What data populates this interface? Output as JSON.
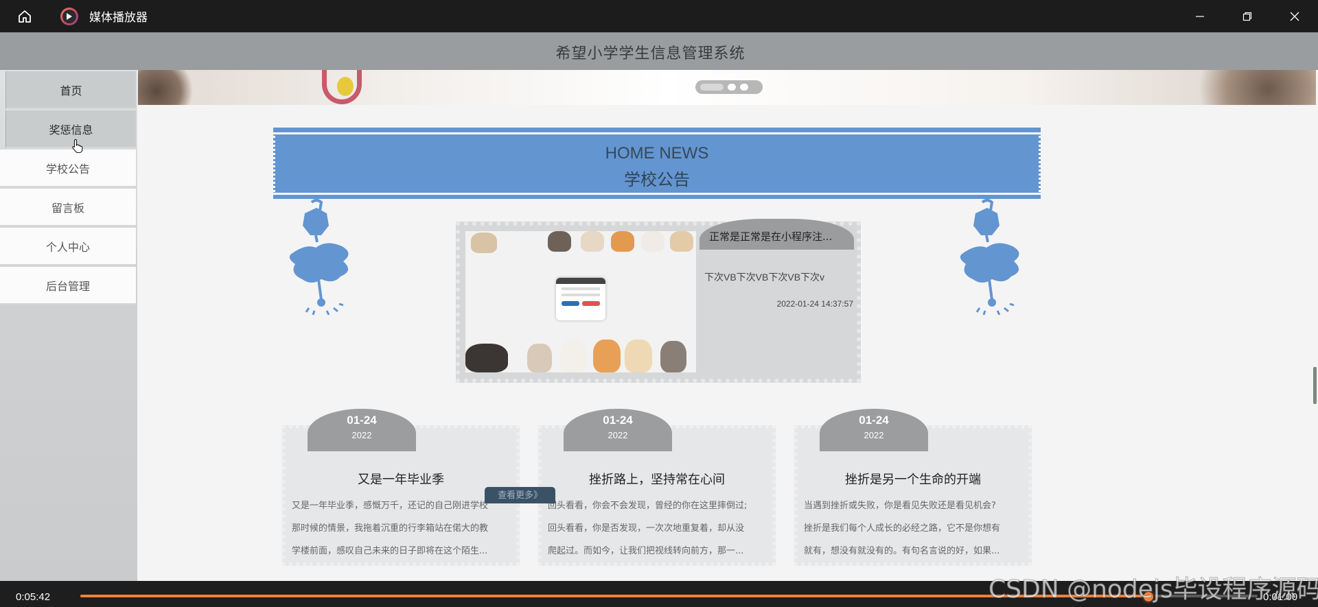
{
  "player": {
    "title": "媒体播放器",
    "time_current": "0:05:42",
    "time_end": "0:01:00",
    "progress": 0.907
  },
  "site": {
    "title": "希望小学学生信息管理系统"
  },
  "sidebar": {
    "items": [
      {
        "label": "首页"
      },
      {
        "label": "奖惩信息"
      },
      {
        "label": "学校公告"
      },
      {
        "label": "留言板"
      },
      {
        "label": "个人中心"
      },
      {
        "label": "后台管理"
      }
    ]
  },
  "news_banner": {
    "title_en": "HOME NEWS",
    "title_cn": "学校公告"
  },
  "featured": {
    "title": "正常是正常是在小程序注...",
    "description": "下次VB下次VB下次VB下次v",
    "datetime": "2022-01-24 14:37:57"
  },
  "cards": [
    {
      "date": "01-24",
      "year": "2022",
      "title": "又是一年毕业季",
      "lines": [
        "又是一年毕业季，感慨万千，还记的自己刚进学校",
        "那时候的情景，我拖着沉重的行李箱站在偌大的教",
        "学楼前面，感叹自己未来的日子即将在这个陌生..."
      ]
    },
    {
      "date": "01-24",
      "year": "2022",
      "title": "挫折路上，坚持常在心间",
      "lines": [
        "回头看看，你会不会发现，曾经的你在这里摔倒过;",
        "回头看看，你是否发现，一次次地重复着，却从没",
        "爬起过。而如今，让我们把视线转向前方，那一..."
      ]
    },
    {
      "date": "01-24",
      "year": "2022",
      "title": "挫折是另一个生命的开端",
      "lines": [
        "当遇到挫折或失败，你是看见失败还是看见机会?",
        "挫折是我们每个人成长的必经之路，它不是你想有",
        "就有，想没有就没有的。有句名言说的好，如果..."
      ]
    }
  ],
  "more_button": "查看更多》",
  "watermark": "CSDN @nodejs毕设程序源码",
  "colors": {
    "accent_blue": "#6395d0",
    "progress_orange": "#f0803a",
    "header_gray": "#999d9f"
  },
  "icons": [
    "home-icon",
    "media-player-logo-icon",
    "minimize-icon",
    "restore-icon",
    "close-icon",
    "hand-cursor-icon"
  ]
}
